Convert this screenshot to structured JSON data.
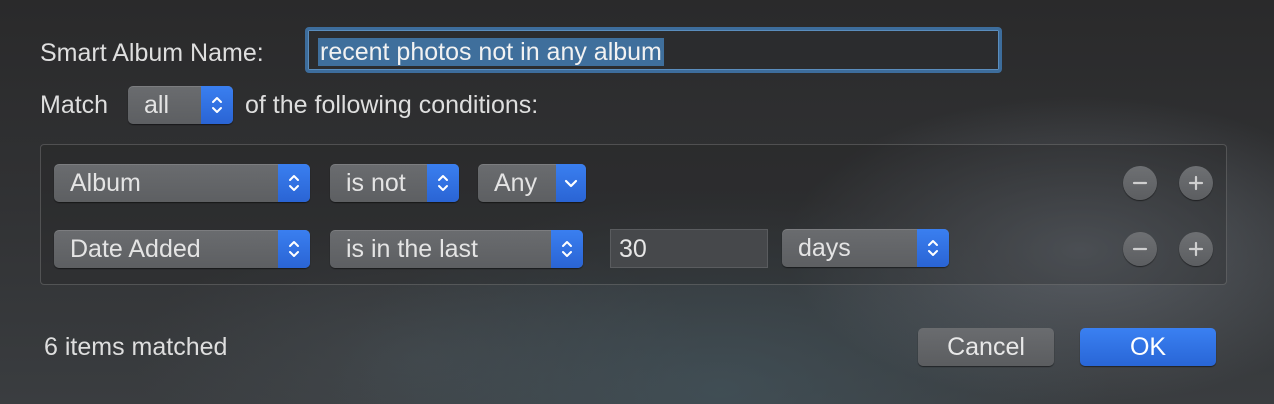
{
  "dialog": {
    "name_label": "Smart Album Name:",
    "name_value": "recent photos not in any album",
    "match_prefix": "Match",
    "match_selected": "all",
    "match_suffix": "of the following conditions:"
  },
  "rules": [
    {
      "field": "Album",
      "operator": "is not",
      "value": "Any",
      "remove_icon": "minus-icon",
      "add_icon": "plus-icon"
    },
    {
      "field": "Date Added",
      "operator": "is in the last",
      "value": "30",
      "unit": "days",
      "remove_icon": "minus-icon",
      "add_icon": "plus-icon"
    }
  ],
  "footer": {
    "status": "6 items matched",
    "cancel_label": "Cancel",
    "ok_label": "OK"
  },
  "colors": {
    "accent": "#2f6fe0",
    "selection": "#3f6f9c",
    "focus_ring": "#3d6d9c"
  }
}
